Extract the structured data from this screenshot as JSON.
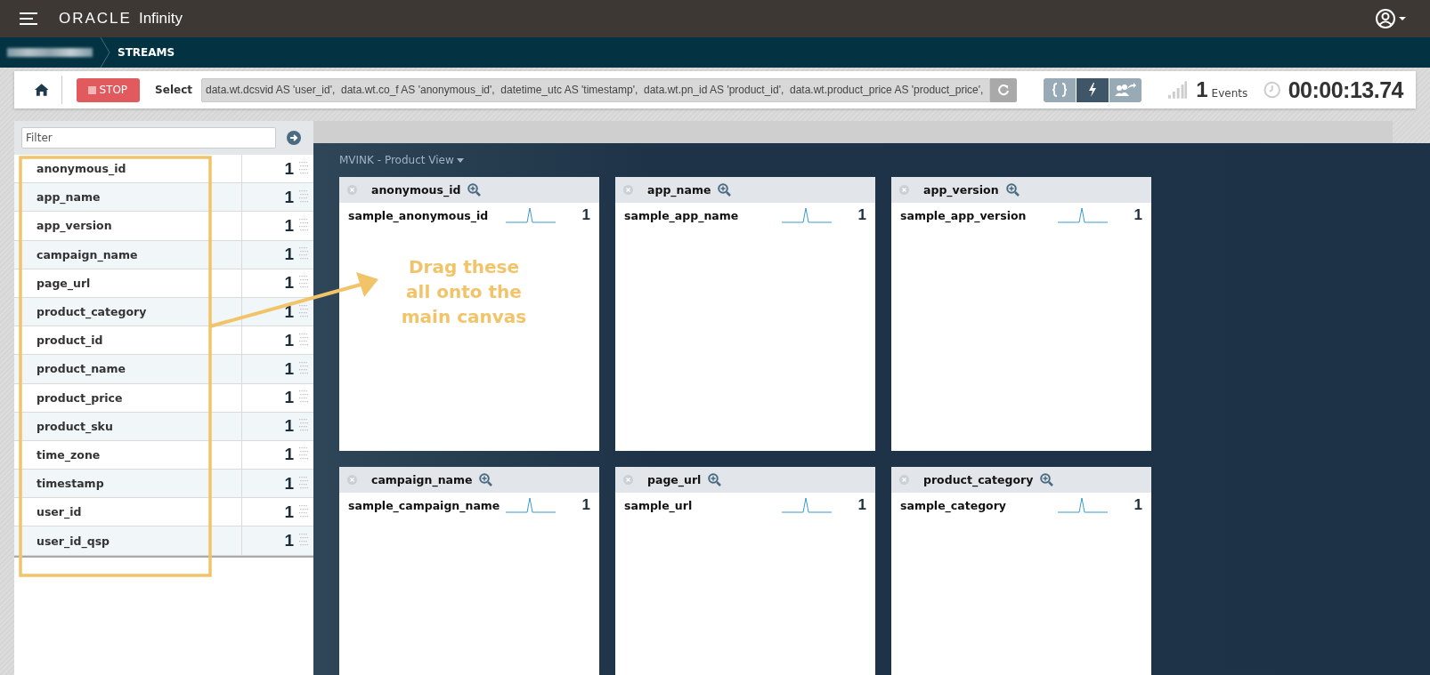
{
  "topbar": {
    "logo": "ORACLE",
    "product": "Infinity"
  },
  "nav": {
    "title": "STREAMS"
  },
  "toolbar": {
    "stop": "STOP",
    "select_label": "Select",
    "query": "data.wt.dcsvid AS 'user_id',  data.wt.co_f AS 'anonymous_id',  datetime_utc AS 'timestamp',  data.wt.pn_id AS 'product_id',  data.wt.product_price AS 'product_price',",
    "modes": [
      {
        "kind": "braces",
        "selected": false
      },
      {
        "kind": "bolt",
        "selected": true
      },
      {
        "kind": "share",
        "selected": false
      }
    ],
    "event_count": "1",
    "events_label": "Events",
    "timer": "00:00:13.74"
  },
  "filter": {
    "placeholder": "Filter"
  },
  "fields": [
    {
      "name": "anonymous_id",
      "count": "1"
    },
    {
      "name": "app_name",
      "count": "1"
    },
    {
      "name": "app_version",
      "count": "1"
    },
    {
      "name": "campaign_name",
      "count": "1"
    },
    {
      "name": "page_url",
      "count": "1"
    },
    {
      "name": "product_category",
      "count": "1"
    },
    {
      "name": "product_id",
      "count": "1"
    },
    {
      "name": "product_name",
      "count": "1"
    },
    {
      "name": "product_price",
      "count": "1"
    },
    {
      "name": "product_sku",
      "count": "1"
    },
    {
      "name": "time_zone",
      "count": "1"
    },
    {
      "name": "timestamp",
      "count": "1"
    },
    {
      "name": "user_id",
      "count": "1"
    },
    {
      "name": "user_id_qsp",
      "count": "1"
    }
  ],
  "canvas": {
    "title": "MVINK - Product View",
    "cards": [
      {
        "title": "anonymous_id",
        "sample": "sample_anonymous_id",
        "count": "1"
      },
      {
        "title": "app_name",
        "sample": "sample_app_name",
        "count": "1"
      },
      {
        "title": "app_version",
        "sample": "sample_app_version",
        "count": "1"
      },
      {
        "title": "campaign_name",
        "sample": "sample_campaign_name",
        "count": "1"
      },
      {
        "title": "page_url",
        "sample": "sample_url",
        "count": "1"
      },
      {
        "title": "product_category",
        "sample": "sample_category",
        "count": "1"
      }
    ]
  },
  "annotation": {
    "text": "Drag these all onto the main canvas"
  }
}
